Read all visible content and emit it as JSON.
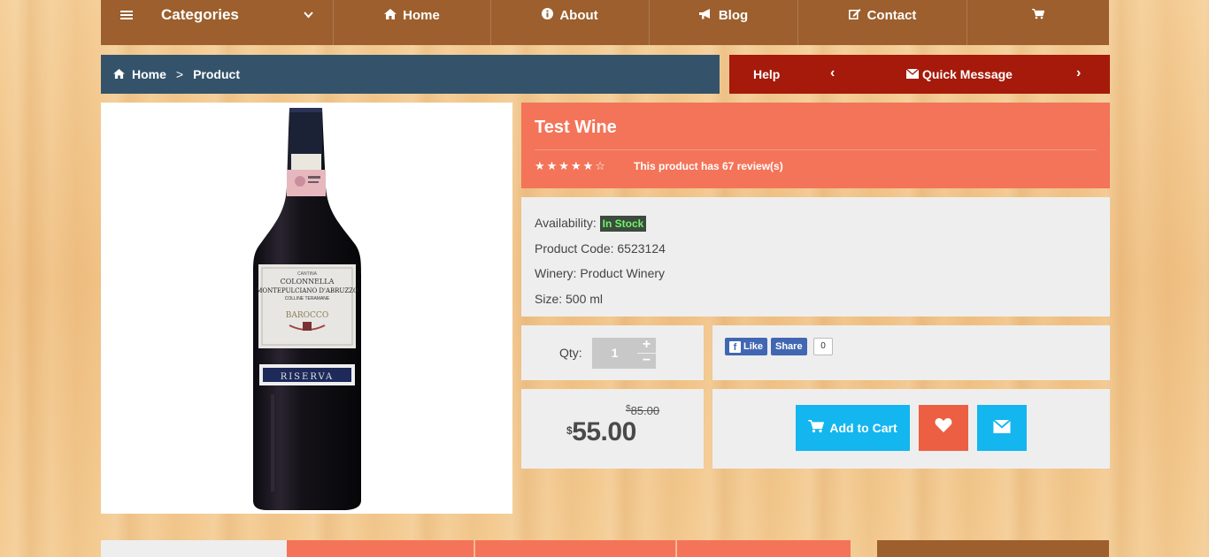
{
  "nav": {
    "categories_label": "Categories",
    "home_label": "Home",
    "about_label": "About",
    "blog_label": "Blog",
    "contact_label": "Contact"
  },
  "breadcrumb": {
    "home_label": "Home",
    "separator": ">",
    "current_label": "Product"
  },
  "helpbar": {
    "help_label": "Help",
    "quick_message_label": "Quick Message",
    "prev_arrow": "‹",
    "next_arrow": "›"
  },
  "product": {
    "title": "Test Wine",
    "rating": 5,
    "rating_max": 6,
    "stars_filled": "★★★★★",
    "stars_empty": "☆",
    "reviews_text": "This product has 67 review(s)",
    "bottle_label_brand": "COLONNELLA",
    "bottle_label_top": "CANTINA",
    "bottle_label_name": "MONTEPULCIANO D'ABRUZZO",
    "bottle_label_sub": "COLLINE TERAMANE",
    "bottle_label_barocco": "BAROCCO",
    "bottle_label_riserva": "RISERVA"
  },
  "info": {
    "availability_label": "Availability:",
    "availability_value": "In Stock",
    "code_label": "Product Code:",
    "code_value": "6523124",
    "winery_label": "Winery:",
    "winery_value": "Product Winery",
    "size_label": "Size:",
    "size_value": "500 ml"
  },
  "quantity": {
    "label": "Qty:",
    "value": "1",
    "plus": "+",
    "minus": "−"
  },
  "social": {
    "like_label": "Like",
    "share_label": "Share",
    "count": "0"
  },
  "price": {
    "currency": "$",
    "old": "85.00",
    "new": "55.00"
  },
  "actions": {
    "add_to_cart_label": "Add to Cart"
  },
  "colors": {
    "nav_bg": "#9c5f2d",
    "breadcrumb_bg": "#34536a",
    "helpbar_bg": "#a51a0a",
    "title_panel_bg": "#f47459",
    "cart_button": "#13b6ee",
    "favorite_button": "#ec5f43",
    "in_stock_text": "#6ef56b"
  },
  "icons": {
    "menu": "menu-icon",
    "chevron": "chevron-down-icon",
    "home": "home-icon",
    "info": "info-icon",
    "blog": "bullhorn-icon",
    "contact": "edit-icon",
    "cart": "cart-icon",
    "mail": "envelope-icon",
    "heart": "heart-icon"
  }
}
